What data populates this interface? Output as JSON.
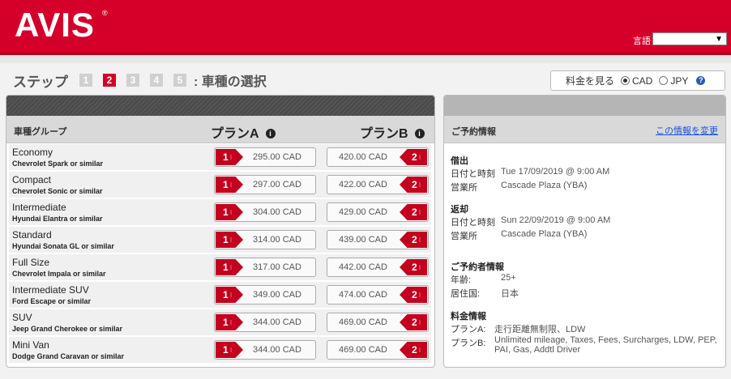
{
  "header": {
    "logo": "AVIS",
    "logo_reg": "®",
    "language_label": "言語",
    "language_selected": "",
    "brand_color": "#d4002a"
  },
  "steps": {
    "label": "ステップ",
    "items": [
      "1",
      "2",
      "3",
      "4",
      "5"
    ],
    "active": "2",
    "title": ": 車種の選択"
  },
  "currency": {
    "label": "料金を見る",
    "options": [
      "CAD",
      "JPY"
    ],
    "selected": "CAD",
    "help_icon": "question-icon"
  },
  "vehicles": {
    "group_header": "車種グループ",
    "plan_a_header": "プランA",
    "plan_b_header": "プランB",
    "plan_a_tag": "1",
    "plan_b_tag": "2",
    "rows": [
      {
        "name": "Economy",
        "model": "Chevrolet Spark or similar",
        "price_a": "295.00 CAD",
        "price_b": "420.00 CAD"
      },
      {
        "name": "Compact",
        "model": "Chevrolet Sonic or similar",
        "price_a": "297.00 CAD",
        "price_b": "422.00 CAD"
      },
      {
        "name": "Intermediate",
        "model": "Hyundai Elantra or similar",
        "price_a": "304.00 CAD",
        "price_b": "429.00 CAD"
      },
      {
        "name": "Standard",
        "model": "Hyundai Sonata GL or similar",
        "price_a": "314.00 CAD",
        "price_b": "439.00 CAD"
      },
      {
        "name": "Full Size",
        "model": "Chevrolet Impala or similar",
        "price_a": "317.00 CAD",
        "price_b": "442.00 CAD"
      },
      {
        "name": "Intermediate SUV",
        "model": "Ford Escape or similar",
        "price_a": "349.00 CAD",
        "price_b": "474.00 CAD"
      },
      {
        "name": "SUV",
        "model": "Jeep Grand Cherokee or similar",
        "price_a": "344.00 CAD",
        "price_b": "469.00 CAD"
      },
      {
        "name": "Mini Van",
        "model": "Dodge Grand Caravan or similar",
        "price_a": "344.00 CAD",
        "price_b": "469.00 CAD"
      }
    ]
  },
  "reservation": {
    "title": "ご予約情報",
    "change_link": "この情報を変更",
    "pickup": {
      "title": "借出",
      "datetime_label": "日付と時刻",
      "datetime": "Tue 17/09/2019 @ 9:00 AM",
      "location_label": "営業所",
      "location": "Cascade Plaza (YBA)"
    },
    "return": {
      "title": "返却",
      "datetime_label": "日付と時刻",
      "datetime": "Sun 22/09/2019 @ 9:00 AM",
      "location_label": "営業所",
      "location": "Cascade Plaza (YBA)"
    },
    "renter": {
      "title": "ご予約者情報",
      "age_label": "年齢:",
      "age": "25+",
      "residence_label": "居住国:",
      "residence": "日本"
    },
    "rates": {
      "title": "料金情報",
      "plan_a_label": "プランA:",
      "plan_a": "走行距離無制限、LDW",
      "plan_b_label": "プランB:",
      "plan_b_line1": "Unlimited mileage, Taxes, Fees, Surcharges, LDW, PEP,",
      "plan_b_line2": "PAI, Gas, Addtl Driver"
    }
  }
}
